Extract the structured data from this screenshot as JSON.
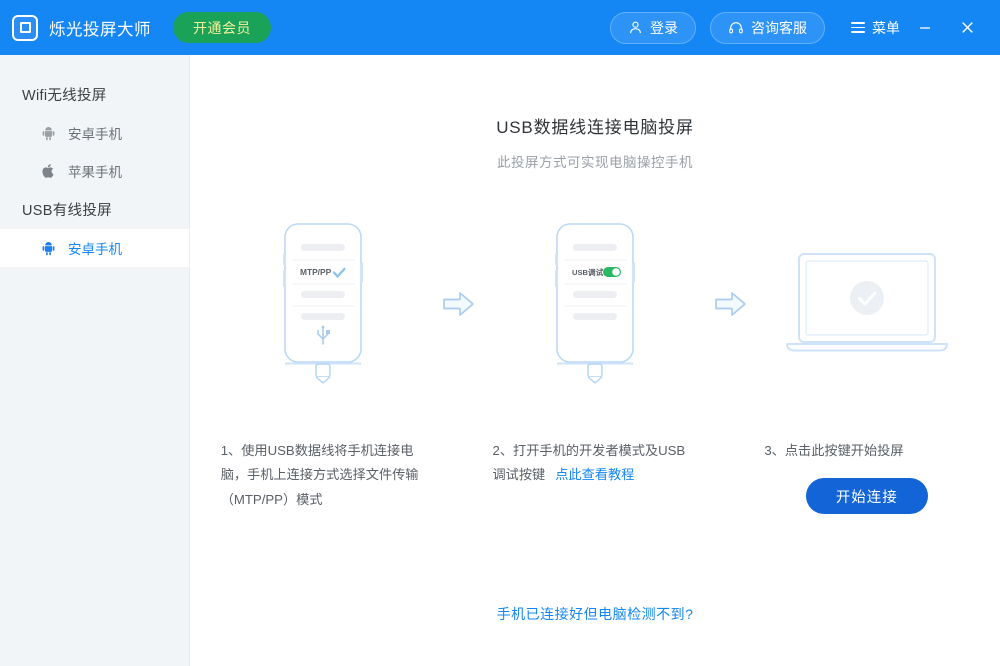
{
  "titlebar": {
    "app_title": "烁光投屏大师",
    "logo_icon": "app-logo-icon",
    "vip_button": "开通会员",
    "login_button": "登录",
    "login_icon": "user-icon",
    "support_button": "咨询客服",
    "support_icon": "headset-icon",
    "menu_button": "菜单",
    "menu_icon": "hamburger-icon",
    "minimize_icon": "minimize-icon",
    "close_icon": "close-icon",
    "bg_color": "#1487f5",
    "vip_bg_color": "#1aa259",
    "vip_text_color": "#f5f09a"
  },
  "sidebar": {
    "groups": [
      {
        "label": "Wifi无线投屏",
        "items": [
          {
            "label": "安卓手机",
            "icon": "android-icon",
            "active": false
          },
          {
            "label": "苹果手机",
            "icon": "apple-icon",
            "active": false
          }
        ]
      },
      {
        "label": "USB有线投屏",
        "items": [
          {
            "label": "安卓手机",
            "icon": "android-icon",
            "active": true
          }
        ]
      }
    ],
    "bg_color": "#f2f5f7",
    "active_color": "#1487f5"
  },
  "main": {
    "title": "USB数据线连接电脑投屏",
    "subtitle": "此投屏方式可实现电脑操控手机",
    "bottom_link": "手机已连接好但电脑检测不到?",
    "steps": [
      {
        "text": "1、使用USB数据线将手机连接电脑，手机上连接方式选择文件传输（MTP/PP）模式",
        "illustration": "phone-mtp-screen",
        "phone_label": "MTP/PP",
        "phone_indicator": "checkmark"
      },
      {
        "text": "2、打开手机的开发者模式及USB调试按键",
        "link_text": "点此查看教程",
        "illustration": "phone-usb-debug-screen",
        "phone_label": "USB调试",
        "phone_indicator": "toggle-on"
      },
      {
        "text": "3、点击此按键开始投屏",
        "button_label": "开始连接",
        "illustration": "laptop-success-screen"
      }
    ],
    "arrow_icon": "arrow-right-icon",
    "button_color": "#1364d6",
    "link_color": "#1487f5"
  }
}
